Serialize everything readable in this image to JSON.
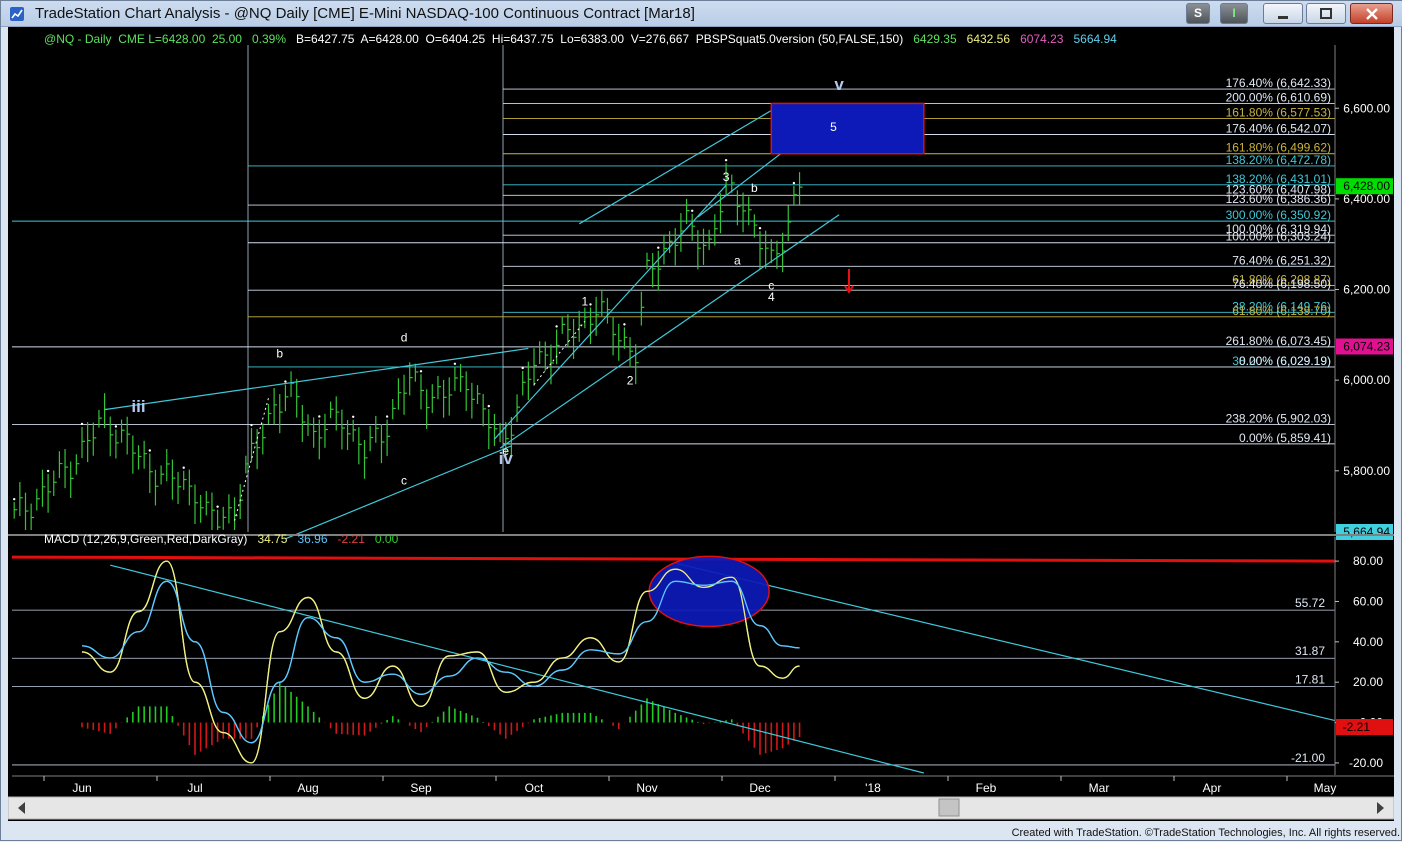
{
  "window": {
    "title": "TradeStation Chart Analysis - @NQ Daily [CME] E-Mini NASDAQ-100 Continuous Contract [Mar18]",
    "buttons": {
      "s": "S",
      "i": "I",
      "minimize": "minimize",
      "maximize": "maximize",
      "close": "close"
    },
    "footer": "Created with TradeStation. ©TradeStation Technologies, Inc. All rights reserved."
  },
  "colors": {
    "background": "#000000",
    "bars": "#35c435",
    "channel": "#3fc8d8",
    "fib": "#c8d8f0",
    "macd": "#f0f080",
    "signal": "#5ac8ff",
    "hist_pos": "#1fcc1f",
    "hist_neg": "#d01818",
    "target_box": "#0d1ab8",
    "target_border": "#e01010",
    "arrow": "#e81010"
  },
  "price_header": {
    "symbol": "@NQ - Daily  CME",
    "last": "L=6428.00",
    "change": "25.00",
    "pct": "0.39%",
    "bid": "B=6427.75",
    "ask": "A=6428.00",
    "open": "O=6404.25",
    "high": "Hi=6437.75",
    "low": "Lo=6383.00",
    "volume": "V=276,667",
    "study": "PBSPSquat5.0version (50,FALSE,150)",
    "v1": "6429.35",
    "v2": "6432.56",
    "v3": "6074.23",
    "v4": "5664.94"
  },
  "macd_header": {
    "name": "MACD (12,26,9,Green,Red,DarkGray)",
    "macd": "34.75",
    "signal": "36.96",
    "diff": "-2.21",
    "zero": "0.00"
  },
  "chart_data": [
    {
      "type": "bar",
      "subtype": "ohlc",
      "panel": "price",
      "ylim": [
        5664.94,
        6680
      ],
      "y_ticks": [
        "6,600.00",
        "6,400.00",
        "6,200.00",
        "6,000.00",
        "5,800.00"
      ],
      "price_tags": [
        {
          "label": "6,428.00",
          "value": 6428,
          "color": "#00dd00"
        },
        {
          "label": "6,074.23",
          "value": 6074.23,
          "color": "#e01090"
        },
        {
          "label": "5,664.94",
          "value": 5664.94,
          "color": "#40d0e0"
        }
      ],
      "fib_levels": [
        {
          "label": "176.40% (6,642.33)",
          "value": 6642.33,
          "color": "#ffffff",
          "start_month": 5.45
        },
        {
          "label": "200.00% (6,610.69)",
          "value": 6610.69,
          "color": "#ffffff",
          "start_month": 5.45
        },
        {
          "label": "161.80% (6,577.53)",
          "value": 6577.53,
          "color": "#c8b440",
          "start_month": 5.45
        },
        {
          "label": "176.40% (6,542.07)",
          "value": 6542.07,
          "color": "#ffffff",
          "start_month": 5.45
        },
        {
          "label": "161.80% (6,499.62)",
          "value": 6499.62,
          "color": "#c8b440",
          "start_month": 5.45
        },
        {
          "label": "138.20% (6,472.78)",
          "value": 6472.78,
          "color": "#3fc8d8",
          "start_month": 2.35
        },
        {
          "label": "138.20% (6,431.01)",
          "value": 6431.01,
          "color": "#3fc8d8",
          "start_month": 5.45
        },
        {
          "label": "123.60% (6,407.98)",
          "value": 6407.98,
          "color": "#ffffff",
          "start_month": 5.45
        },
        {
          "label": "123.60% (6,386.36)",
          "value": 6386.36,
          "color": "#ffffff",
          "start_month": 2.35
        },
        {
          "label": "300.00% (6,350.92)",
          "value": 6350.92,
          "color": "#3fc8d8",
          "start_month": 0.0
        },
        {
          "label": "100.00% (6,319.94)",
          "value": 6319.94,
          "color": "#ffffff",
          "start_month": 5.45
        },
        {
          "label": "100.00% (6,303.24)",
          "value": 6303.24,
          "color": "#ffffff",
          "start_month": 2.35
        },
        {
          "label": "76.40% (6,251.32)",
          "value": 6251.32,
          "color": "#ffffff",
          "start_month": 5.45
        },
        {
          "label": "61.80% (6,208.87)",
          "value": 6208.87,
          "color": "#c8b440",
          "start_month": 5.45
        },
        {
          "label": "76.40% (6,198.50)",
          "value": 6198.5,
          "color": "#ffffff",
          "start_month": 2.35
        },
        {
          "label": "38.20% (6,149.76)",
          "value": 6149.76,
          "color": "#3fc8d8",
          "start_month": 5.45
        },
        {
          "label": "61.80% (6,139.70)",
          "value": 6139.7,
          "color": "#c8b440",
          "start_month": 2.35
        },
        {
          "label": "261.80% (6,073.45)",
          "value": 6073.45,
          "color": "#ffffff",
          "start_month": 0.0
        },
        {
          "label": "38.20% (6,029.19)",
          "value": 6029.19,
          "color": "#3fc8d8",
          "start_month": 2.35
        },
        {
          "label": "0.00% (6,029.19)",
          "value": 6029.19,
          "color": "#ffffff",
          "start_month": 5.45
        },
        {
          "label": "238.20% (5,902.03)",
          "value": 5902.03,
          "color": "#ffffff",
          "start_month": 0.0
        },
        {
          "label": "0.00% (5,859.41)",
          "value": 5859.41,
          "color": "#ffffff",
          "start_month": 5.45
        }
      ],
      "wave_labels": [
        {
          "text": "iii",
          "month": 0.5,
          "price": 5930,
          "big": true
        },
        {
          "text": "b",
          "month": 1.75,
          "price": 6050,
          "big": false
        },
        {
          "text": "d",
          "month": 2.85,
          "price": 6085,
          "big": false
        },
        {
          "text": "c",
          "month": 2.85,
          "price": 5770,
          "big": false
        },
        {
          "text": "e",
          "month": 3.75,
          "price": 5835,
          "big": false
        },
        {
          "text": "iv",
          "month": 3.75,
          "price": 5815,
          "big": true
        },
        {
          "text": "1",
          "month": 4.45,
          "price": 6165,
          "big": false
        },
        {
          "text": "2",
          "month": 4.85,
          "price": 5990,
          "big": false
        },
        {
          "text": "3",
          "month": 5.7,
          "price": 6440,
          "big": false
        },
        {
          "text": "b",
          "month": 5.95,
          "price": 6415,
          "big": false
        },
        {
          "text": "a",
          "month": 5.8,
          "price": 6255,
          "big": false
        },
        {
          "text": "c",
          "month": 6.1,
          "price": 6200,
          "big": false
        },
        {
          "text": "4",
          "month": 6.1,
          "price": 6175,
          "big": false
        },
        {
          "text": "5",
          "month": 6.65,
          "price": 6550,
          "big": false
        },
        {
          "text": "v",
          "month": 6.7,
          "price": 6640,
          "big": true
        }
      ],
      "target_box": {
        "month_start": 6.1,
        "month_end": 7.45,
        "price_low": 6499.62,
        "price_high": 6610.69
      }
    },
    {
      "type": "line",
      "panel": "macd",
      "title": "MACD (12,26,9,Green,Red,DarkGray)",
      "ylim": [
        -25,
        86
      ],
      "y_ticks": [
        "80.00",
        "60.00",
        "40.00",
        "20.00",
        "0.00",
        "-20.00"
      ],
      "levels": [
        {
          "label": "55.72",
          "value": 55.72
        },
        {
          "label": "31.87",
          "value": 31.87
        },
        {
          "label": "17.81",
          "value": 17.81
        },
        {
          "label": "-21.00",
          "value": -21.0
        }
      ],
      "tag": {
        "label": "-2.21",
        "value": -2.21,
        "color": "#e01010"
      },
      "x_month_pos": [
        0,
        0.25,
        0.5,
        0.75,
        1.0,
        1.25,
        1.5,
        1.75,
        2.0,
        2.25,
        2.5,
        2.75,
        3.0,
        3.25,
        3.5,
        3.75,
        4.0,
        4.25,
        4.5,
        4.75,
        5.0,
        5.25,
        5.5,
        5.75,
        6.0,
        6.2,
        6.35
      ],
      "series": [
        {
          "name": "MACD",
          "values": [
            35,
            25,
            55,
            80,
            20,
            -5,
            -20,
            45,
            62,
            35,
            12,
            28,
            8,
            33,
            35,
            15,
            20,
            32,
            42,
            30,
            65,
            76,
            67,
            72,
            28,
            22,
            28
          ]
        },
        {
          "name": "Signal",
          "values": [
            38,
            32,
            45,
            70,
            40,
            5,
            -10,
            20,
            52,
            42,
            20,
            24,
            14,
            23,
            32,
            25,
            18,
            26,
            36,
            34,
            50,
            70,
            68,
            70,
            48,
            38,
            37
          ]
        }
      ]
    }
  ],
  "x_axis": {
    "labels": [
      "Jun",
      "Jul",
      "Aug",
      "Sep",
      "Oct",
      "Nov",
      "Dec",
      "'18",
      "Feb",
      "Mar",
      "Apr",
      "May"
    ],
    "month_pos": [
      0,
      1,
      2,
      3,
      4,
      5,
      6,
      7,
      8,
      9,
      10,
      11
    ]
  }
}
